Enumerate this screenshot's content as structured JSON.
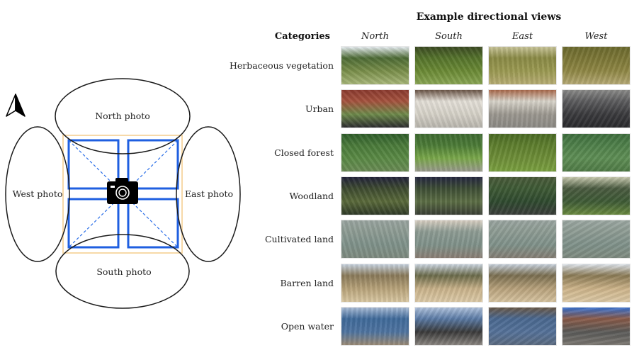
{
  "title": "Example directional views",
  "categories_header": "Categories",
  "directions": [
    "North",
    "South",
    "East",
    "West"
  ],
  "diagram": {
    "labels": {
      "north": "North photo",
      "south": "South photo",
      "east": "East photo",
      "west": "West photo"
    },
    "icons": [
      "north-arrow-icon",
      "camera-icon"
    ],
    "colors": {
      "frame": "#1f5fe0",
      "outer_square": "#f7d9a8",
      "ellipse": "#1a1a1a",
      "camera": "#000000"
    }
  },
  "rows": [
    {
      "label": "Herbaceous vegetation",
      "photos": [
        {
          "direction": "North",
          "sky": "#e8eef2",
          "top": "#4d6b35",
          "mid": "#7a8f4a",
          "bottom": "#a8b77a"
        },
        {
          "direction": "South",
          "sky": "#3b4a22",
          "top": "#55732c",
          "mid": "#6b8a35",
          "bottom": "#8aa655"
        },
        {
          "direction": "East",
          "sky": "#c9c59a",
          "top": "#8a8a45",
          "mid": "#9b9a52",
          "bottom": "#b7ad75"
        },
        {
          "direction": "West",
          "sky": "#6b6a2e",
          "top": "#7b7636",
          "mid": "#8f8745",
          "bottom": "#b6aa76"
        }
      ]
    },
    {
      "label": "Urban",
      "photos": [
        {
          "direction": "North",
          "sky": "#8b3a2e",
          "top": "#a5523e",
          "mid": "#6d8a4a",
          "bottom": "#2d2d30"
        },
        {
          "direction": "South",
          "sky": "#6a5446",
          "top": "#e4e0d8",
          "mid": "#d6d2c8",
          "bottom": "#b9b6ae"
        },
        {
          "direction": "East",
          "sky": "#a8684a",
          "top": "#d9d5cb",
          "mid": "#9c9890",
          "bottom": "#8c8a85"
        },
        {
          "direction": "West",
          "sky": "#8a8a88",
          "top": "#5c5c5e",
          "mid": "#3a3a3d",
          "bottom": "#2a2a2d"
        }
      ]
    },
    {
      "label": "Closed forest",
      "photos": [
        {
          "direction": "North",
          "sky": "#2f5d2a",
          "top": "#4a7a3a",
          "mid": "#5a8a45",
          "bottom": "#6a8a55"
        },
        {
          "direction": "South",
          "sky": "#3f6a32",
          "top": "#4b7a36",
          "mid": "#7aa84a",
          "bottom": "#9a9a8e"
        },
        {
          "direction": "East",
          "sky": "#4a6a25",
          "top": "#5e7e2e",
          "mid": "#6e8e38",
          "bottom": "#7aa040"
        },
        {
          "direction": "West",
          "sky": "#3e6e3e",
          "top": "#4f804a",
          "mid": "#5e8e55",
          "bottom": "#4f7a45"
        }
      ]
    },
    {
      "label": "Woodland",
      "photos": [
        {
          "direction": "North",
          "sky": "#23243a",
          "top": "#3d4a30",
          "mid": "#5a6a3a",
          "bottom": "#2f3a28"
        },
        {
          "direction": "South",
          "sky": "#262840",
          "top": "#3d4d35",
          "mid": "#5c6e45",
          "bottom": "#3a3f35"
        },
        {
          "direction": "East",
          "sky": "#4a5a3a",
          "top": "#3e5a35",
          "mid": "#2f4a2f",
          "bottom": "#3a3e3a"
        },
        {
          "direction": "West",
          "sky": "#c9cbb0",
          "top": "#4a5a40",
          "mid": "#3e5a35",
          "bottom": "#6a8a40"
        }
      ]
    },
    {
      "label": "Cultivated land",
      "photos": [
        {
          "direction": "North",
          "sky": "#9aa5a0",
          "top": "#8e9c94",
          "mid": "#7f928a",
          "bottom": "#7e8a80"
        },
        {
          "direction": "South",
          "sky": "#d8cfc2",
          "top": "#8e9c94",
          "mid": "#80928a",
          "bottom": "#8a7f75"
        },
        {
          "direction": "East",
          "sky": "#9aa5a0",
          "top": "#8e9c94",
          "mid": "#80928a",
          "bottom": "#857f75"
        },
        {
          "direction": "West",
          "sky": "#9ca8a2",
          "top": "#8e9c94",
          "mid": "#80928a",
          "bottom": "#7e8a80"
        }
      ]
    },
    {
      "label": "Barren land",
      "photos": [
        {
          "direction": "North",
          "sky": "#c7d3e0",
          "top": "#8a7a5a",
          "mid": "#b8a37a",
          "bottom": "#d8c7a2"
        },
        {
          "direction": "South",
          "sky": "#cbd5e0",
          "top": "#6a6a4a",
          "mid": "#c9b28a",
          "bottom": "#dccaa8"
        },
        {
          "direction": "East",
          "sky": "#c7d1dc",
          "top": "#7a6e50",
          "mid": "#b8a27c",
          "bottom": "#d6c3a0"
        },
        {
          "direction": "West",
          "sky": "#dde3ea",
          "top": "#8a7a55",
          "mid": "#cdb48a",
          "bottom": "#dbc8a5"
        }
      ]
    },
    {
      "label": "Open water",
      "photos": [
        {
          "direction": "North",
          "sky": "#a9bcd6",
          "top": "#3f6a9a",
          "mid": "#4f74a0",
          "bottom": "#9a8a75"
        },
        {
          "direction": "South",
          "sky": "#b0c2dc",
          "top": "#5a7aa5",
          "mid": "#3a3a3a",
          "bottom": "#8a8580"
        },
        {
          "direction": "East",
          "sky": "#6a5a4a",
          "top": "#4a6890",
          "mid": "#557299",
          "bottom": "#5a6a80"
        },
        {
          "direction": "West",
          "sky": "#3a72d0",
          "top": "#8a5a48",
          "mid": "#5a5a58",
          "bottom": "#7a7670"
        }
      ]
    }
  ]
}
